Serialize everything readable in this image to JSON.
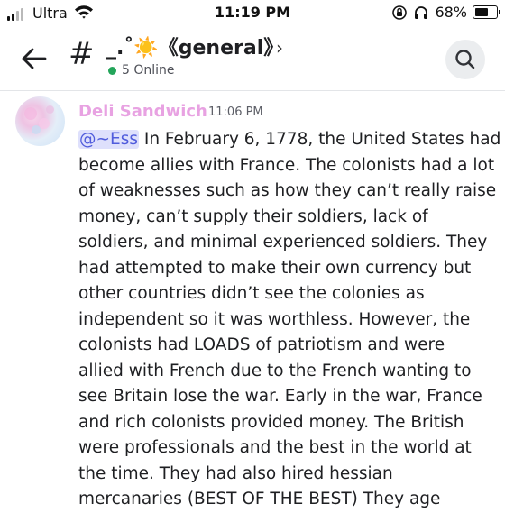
{
  "status_bar": {
    "carrier": "Ultra",
    "time": "11:19 PM",
    "battery_percent": "68%",
    "battery_level": 0.68
  },
  "header": {
    "channel_name": "_.˚☀️《general》",
    "online_text": "5 Online",
    "icons": [
      "back-arrow-icon",
      "hash-icon",
      "chevron-right-icon",
      "search-icon"
    ]
  },
  "message": {
    "author": "Deli Sandwich",
    "timestamp": "11:06 PM",
    "mention": "@~Ess",
    "lines": [
      "In February 6, 1778, the United States had",
      "become allies with France. The colonists had a lot",
      "of weaknesses such as how they can’t really raise",
      "money, can’t supply their soldiers, lack of",
      "soldiers, and minimal experienced soldiers. They",
      "had attempted to make their own currency but",
      "other countries didn’t see the colonies as",
      "independent so it was worthless. However, the",
      "colonists had LOADS of patriotism and were",
      "allied with French due to the French wanting to",
      "see Britain lose the war. Early in the war, France",
      "and rich colonists provided money. The British",
      "were professionals and the best in the world at",
      "the time. They had also hired hessian",
      "mercanaries (BEST OF THE BEST) They age"
    ]
  },
  "colors": {
    "username": "#e8a2e2",
    "mention_bg": "#dee0fc",
    "mention_text": "#505cdc",
    "online": "#23a55a"
  }
}
